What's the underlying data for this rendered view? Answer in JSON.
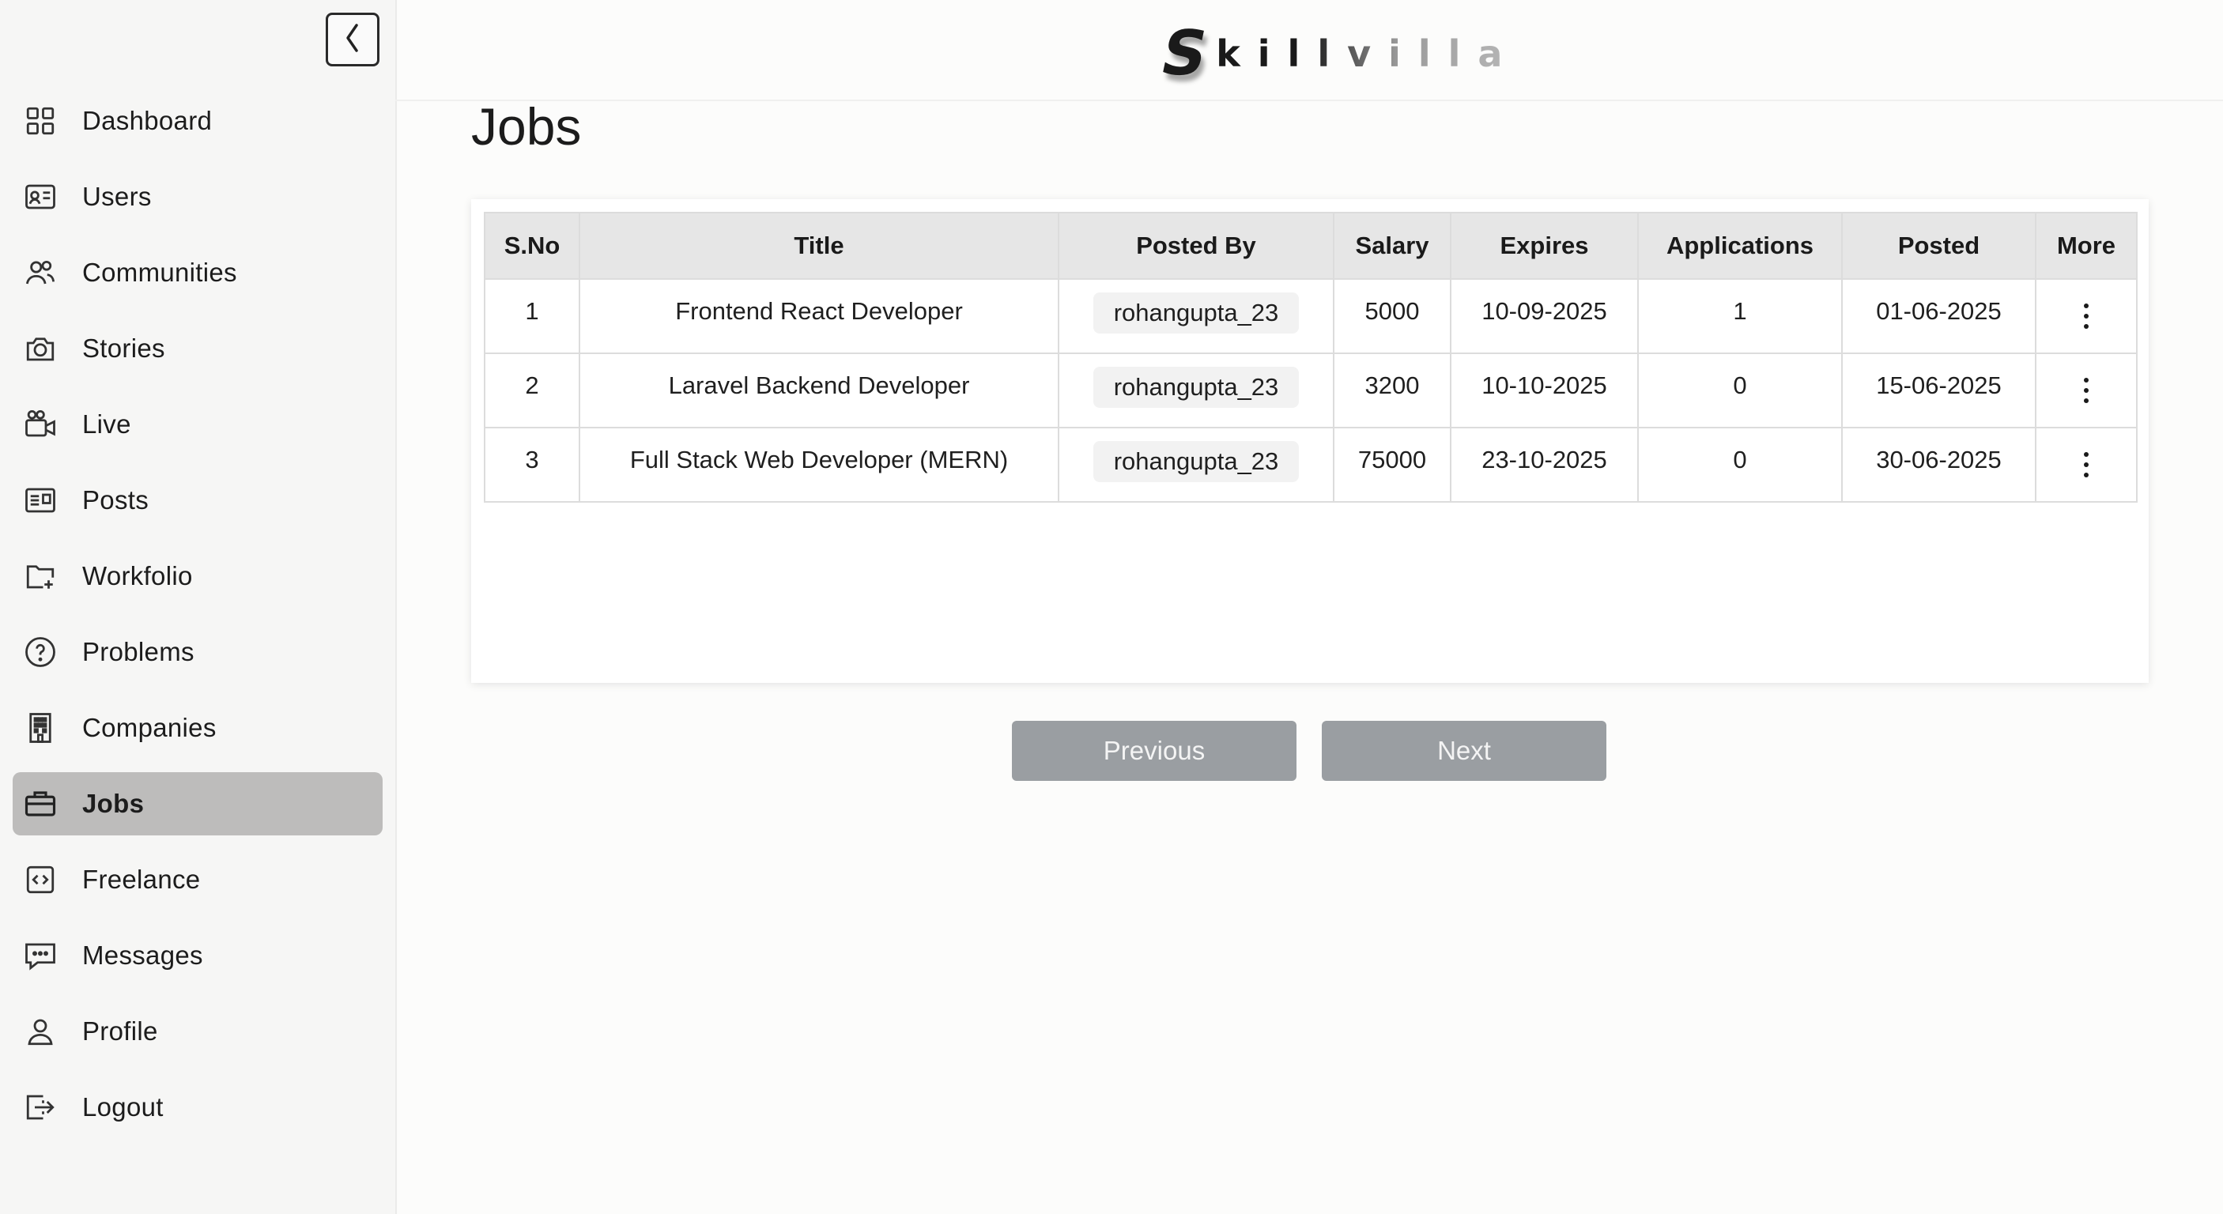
{
  "brand": {
    "logo_initial": "S",
    "logo_rest": "killvilla"
  },
  "sidebar": {
    "collapse_icon": "chevron-left-icon",
    "items": [
      {
        "label": "Dashboard",
        "icon": "grid-icon"
      },
      {
        "label": "Users",
        "icon": "id-card-icon"
      },
      {
        "label": "Communities",
        "icon": "users-icon"
      },
      {
        "label": "Stories",
        "icon": "camera-icon"
      },
      {
        "label": "Live",
        "icon": "video-icon"
      },
      {
        "label": "Posts",
        "icon": "newspaper-icon"
      },
      {
        "label": "Workfolio",
        "icon": "folder-plus-icon"
      },
      {
        "label": "Problems",
        "icon": "question-icon"
      },
      {
        "label": "Companies",
        "icon": "building-icon"
      },
      {
        "label": "Jobs",
        "icon": "briefcase-icon",
        "active": true
      },
      {
        "label": "Freelance",
        "icon": "code-icon"
      },
      {
        "label": "Messages",
        "icon": "message-icon"
      },
      {
        "label": "Profile",
        "icon": "person-icon"
      },
      {
        "label": "Logout",
        "icon": "logout-icon"
      }
    ]
  },
  "main": {
    "title": "Jobs",
    "table": {
      "headers": [
        "S.No",
        "Title",
        "Posted By",
        "Salary",
        "Expires",
        "Applications",
        "Posted",
        "More"
      ],
      "rows": [
        {
          "sno": "1",
          "title": "Frontend React Developer",
          "posted_by": "rohangupta_23",
          "salary": "5000",
          "expires": "10-09-2025",
          "applications": "1",
          "posted": "01-06-2025"
        },
        {
          "sno": "2",
          "title": "Laravel Backend Developer",
          "posted_by": "rohangupta_23",
          "salary": "3200",
          "expires": "10-10-2025",
          "applications": "0",
          "posted": "15-06-2025"
        },
        {
          "sno": "3",
          "title": "Full Stack Web Developer (MERN)",
          "posted_by": "rohangupta_23",
          "salary": "75000",
          "expires": "23-10-2025",
          "applications": "0",
          "posted": "30-06-2025"
        }
      ]
    },
    "pagination": {
      "previous_label": "Previous",
      "next_label": "Next"
    }
  }
}
